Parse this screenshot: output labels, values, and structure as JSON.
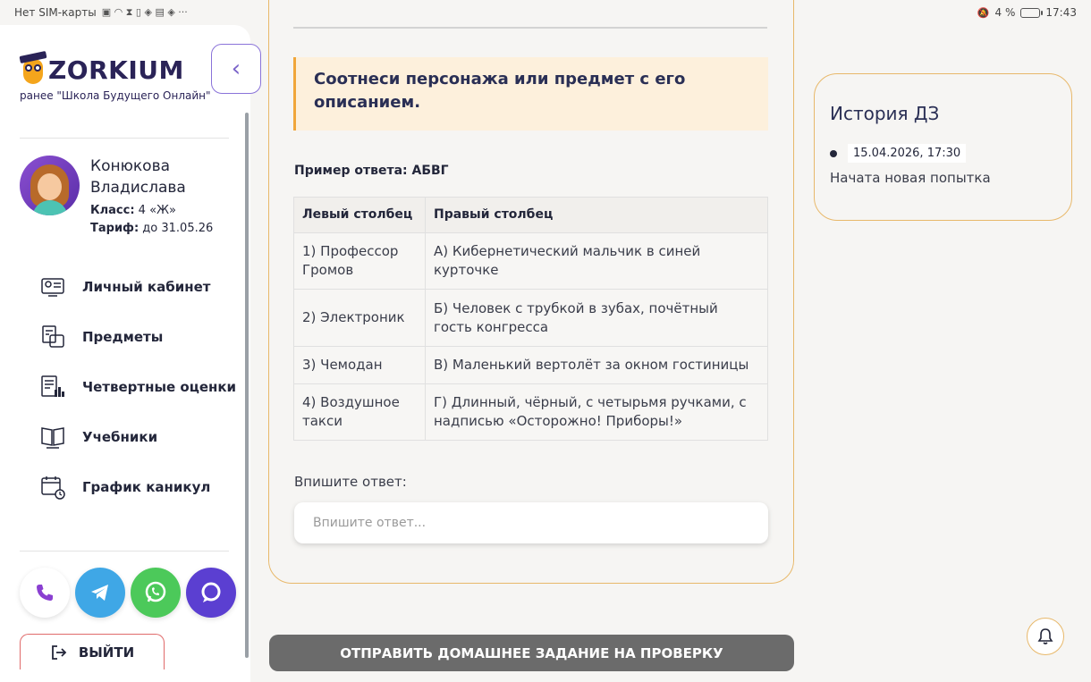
{
  "status_bar": {
    "carrier": "Нет SIM-карты",
    "battery": "4 %",
    "time": "17:43"
  },
  "sidebar": {
    "logo_text": "ZORKIUM",
    "logo_subtitle": "ранее \"Школа Будущего Онлайн\"",
    "user": {
      "first_line": "Конюкова",
      "second_line": "Владислава",
      "class_label": "Класс:",
      "class_value": "4 «Ж»",
      "tariff_label": "Тариф:",
      "tariff_value": "до 31.05.26"
    },
    "nav": [
      {
        "label": "Личный кабинет",
        "icon": "profile-monitor-icon"
      },
      {
        "label": "Предметы",
        "icon": "subjects-icon"
      },
      {
        "label": "Четвертные оценки",
        "icon": "grades-chart-icon"
      },
      {
        "label": "Учебники",
        "icon": "book-icon"
      },
      {
        "label": "График каникул",
        "icon": "calendar-clock-icon"
      }
    ],
    "logout_label": "ВЫЙТИ"
  },
  "task": {
    "instruction": "Соотнеси персонажа или предмет с его описанием.",
    "example": "Пример ответа: АБВГ",
    "table": {
      "headers": [
        "Левый столбец",
        "Правый столбец"
      ],
      "rows": [
        [
          "1) Профессор Громов",
          "А) Кибернетический мальчик в синей курточке"
        ],
        [
          "2) Электроник",
          "Б) Человек с трубкой в зубах, почётный гость конгресса"
        ],
        [
          "3) Чемодан",
          "В) Маленький вертолёт за окном гостиницы"
        ],
        [
          "4) Воздушное такси",
          "Г) Длинный, чёрный, с четырьмя ручками, с надписью «Осторожно! Приборы!»"
        ]
      ]
    },
    "answer_label": "Впишите ответ:",
    "answer_placeholder": "Впишите ответ...",
    "answer_value": "",
    "submit_label": "ОТПРАВИТЬ ДОМАШНЕЕ ЗАДАНИЕ НА ПРОВЕРКУ"
  },
  "history": {
    "title": "История ДЗ",
    "entries": [
      {
        "date": "15.04.2026, 17:30",
        "text": "Начата новая попытка"
      }
    ]
  },
  "colors": {
    "accent_orange": "#e8b86a",
    "brand_purple": "#2a2357",
    "submit_gray": "#6b6b6b",
    "telegram": "#3fa7e6",
    "whatsapp": "#4cc95a",
    "chat": "#5b3fd1"
  }
}
